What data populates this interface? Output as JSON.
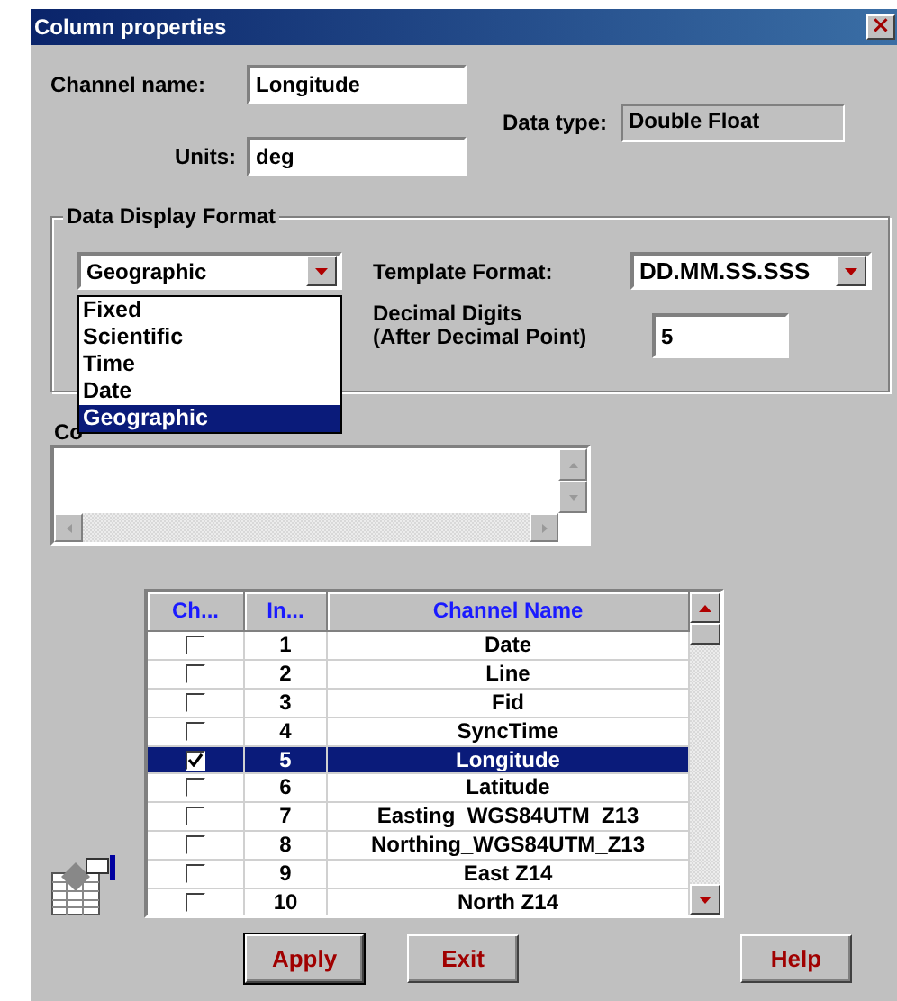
{
  "window": {
    "title": "Column properties",
    "close": "×"
  },
  "channel_name": {
    "label": "Channel name:",
    "value": "Longitude"
  },
  "data_type": {
    "label": "Data type:",
    "value": "Double Float"
  },
  "units": {
    "label": "Units:",
    "value": "deg"
  },
  "display_format": {
    "legend": "Data Display Format",
    "format_combo": {
      "value": "Geographic",
      "expanded": true,
      "options": [
        {
          "label": "Fixed",
          "selected": false
        },
        {
          "label": "Scientific",
          "selected": false
        },
        {
          "label": "Time",
          "selected": false
        },
        {
          "label": "Date",
          "selected": false
        },
        {
          "label": "Geographic",
          "selected": true
        }
      ]
    },
    "template": {
      "label": "Template Format:",
      "value": "DD.MM.SS.SSS"
    },
    "decimal_digits": {
      "label": "Decimal Digits\n(After Decimal Point)",
      "value": "5"
    }
  },
  "computing_formula": {
    "label": "Co"
  },
  "table": {
    "columns": [
      "Ch...",
      "In...",
      "Channel Name"
    ],
    "rows": [
      {
        "checked": false,
        "selected": false,
        "index": "1",
        "name": "Date"
      },
      {
        "checked": false,
        "selected": false,
        "index": "2",
        "name": "Line"
      },
      {
        "checked": false,
        "selected": false,
        "index": "3",
        "name": "Fid"
      },
      {
        "checked": false,
        "selected": false,
        "index": "4",
        "name": "SyncTime"
      },
      {
        "checked": true,
        "selected": true,
        "index": "5",
        "name": "Longitude"
      },
      {
        "checked": false,
        "selected": false,
        "index": "6",
        "name": "Latitude"
      },
      {
        "checked": false,
        "selected": false,
        "index": "7",
        "name": "Easting_WGS84UTM_Z13"
      },
      {
        "checked": false,
        "selected": false,
        "index": "8",
        "name": "Northing_WGS84UTM_Z13"
      },
      {
        "checked": false,
        "selected": false,
        "index": "9",
        "name": "East Z14"
      },
      {
        "checked": false,
        "selected": false,
        "index": "10",
        "name": "North Z14"
      }
    ]
  },
  "buttons": [
    "Apply",
    "Exit",
    "Help"
  ]
}
